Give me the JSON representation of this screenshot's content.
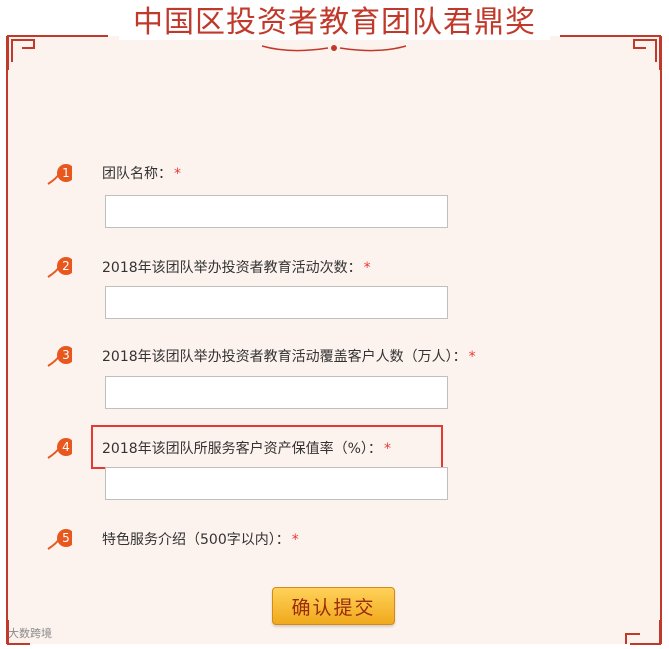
{
  "header": {
    "title": "中国区投资者教育团队君鼎奖"
  },
  "form": {
    "required_mark": "*",
    "questions": [
      {
        "number": "1",
        "label": "团队名称：",
        "value": ""
      },
      {
        "number": "2",
        "label": "2018年该团队举办投资者教育活动次数：",
        "value": ""
      },
      {
        "number": "3",
        "label": "2018年该团队举办投资者教育活动覆盖客户人数（万人）：",
        "value": ""
      },
      {
        "number": "4",
        "label": "2018年该团队所服务客户资产保值率（%）：",
        "value": ""
      },
      {
        "number": "5",
        "label": "特色服务介绍（500字以内）："
      }
    ],
    "submit_label": "确认提交"
  },
  "watermark": {
    "text": "大数跨境"
  },
  "colors": {
    "accent": "#c0392b",
    "badge": "#e8571e",
    "required": "#e53935",
    "button": "#f6b52c",
    "panel_bg": "#fdf3ee"
  }
}
